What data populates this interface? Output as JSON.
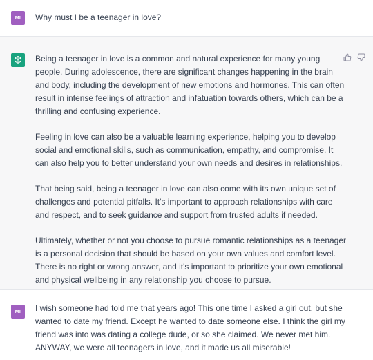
{
  "colors": {
    "user_avatar": "#a05fc0",
    "bot_avatar": "#19a37f",
    "assistant_bg": "#f7f7f8",
    "text": "#374151"
  },
  "messages": {
    "first_user": {
      "avatar": "MI",
      "text": "Why must I be a teenager in love?"
    },
    "assistant": {
      "avatar_icon": "chatgpt-logo-icon",
      "paragraphs": [
        "Being a teenager in love is a common and natural experience for many young people. During adolescence, there are significant changes happening in the brain and body, including the development of new emotions and hormones. This can often result in intense feelings of attraction and infatuation towards others, which can be a thrilling and confusing experience.",
        "Feeling in love can also be a valuable learning experience, helping you to develop social and emotional skills, such as communication, empathy, and compromise. It can also help you to better understand your own needs and desires in relationships.",
        "That being said, being a teenager in love can also come with its own unique set of challenges and potential pitfalls. It's important to approach relationships with care and respect, and to seek guidance and support from trusted adults if needed.",
        "Ultimately, whether or not you choose to pursue romantic relationships as a teenager is a personal decision that should be based on your own values and comfort level. There is no right or wrong answer, and it's important to prioritize your own emotional and physical wellbeing in any relationship you choose to pursue."
      ],
      "feedback_icons": [
        "thumbs-up-icon",
        "thumbs-down-icon"
      ]
    },
    "second_user": {
      "avatar": "MI",
      "text": "I wish someone had told me that years ago! This one time I asked a girl out, but she wanted to date my friend. Except he wanted to date someone else. I think the girl my friend was into was dating a college dude, or so she claimed. We never met him. ANYWAY, we were all teenagers in love, and it made us all miserable!"
    }
  }
}
